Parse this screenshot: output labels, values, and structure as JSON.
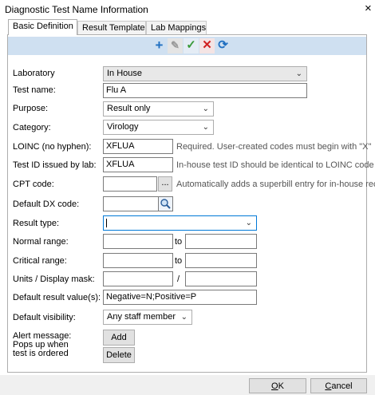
{
  "window": {
    "title": "Diagnostic Test Name Information",
    "close": "×"
  },
  "tabs": [
    {
      "label": "Basic Definition"
    },
    {
      "label": "Result Template"
    },
    {
      "label": "Lab Mappings"
    }
  ],
  "toolbar": {
    "add": "+",
    "edit": "✎",
    "save": "✓",
    "cancel": "✕",
    "refresh": "⟳"
  },
  "form": {
    "laboratory": {
      "label": "Laboratory",
      "value": "In House"
    },
    "test_name": {
      "label": "Test name:",
      "value": "Flu A"
    },
    "purpose": {
      "label": "Purpose:",
      "value": "Result only"
    },
    "category": {
      "label": "Category:",
      "value": "Virology"
    },
    "loinc": {
      "label": "LOINC (no hyphen):",
      "value": "XFLUA",
      "hint": "Required. User-created codes must begin with \"X\""
    },
    "test_id": {
      "label": "Test ID issued by lab:",
      "value": "XFLUA",
      "hint": "In-house test ID should be identical to LOINC code"
    },
    "cpt": {
      "label": "CPT code:",
      "value": "",
      "browse": "...",
      "hint": "Automatically adds a superbill entry for in-house rec"
    },
    "dx": {
      "label": "Default DX code:",
      "value": ""
    },
    "result_type": {
      "label": "Result type:",
      "value": ""
    },
    "normal_range": {
      "label": "Normal range:",
      "low": "",
      "to": "to",
      "high": ""
    },
    "critical_range": {
      "label": "Critical range:",
      "low": "",
      "to": "to",
      "high": ""
    },
    "units": {
      "label": "Units / Display mask:",
      "unit": "",
      "slash": "/",
      "mask": ""
    },
    "default_result": {
      "label": "Default result value(s):",
      "value": "Negative=N;Positive=P"
    },
    "visibility": {
      "label": "Default visibility:",
      "value": "Any staff member"
    },
    "alert": {
      "line1": "Alert message:",
      "line2": "Pops up when",
      "line3": "test is ordered",
      "add": "Add",
      "delete": "Delete"
    }
  },
  "footer": {
    "ok_prefix": "",
    "ok_u": "O",
    "ok_rest": "K",
    "cancel_u": "C",
    "cancel_rest": "ancel"
  },
  "colors": {
    "toolbar_bg": "#cfe0f1",
    "add": "#1f6fc1",
    "save": "#3a9a3a",
    "cancel": "#d02020",
    "refresh": "#1f6fc1"
  }
}
